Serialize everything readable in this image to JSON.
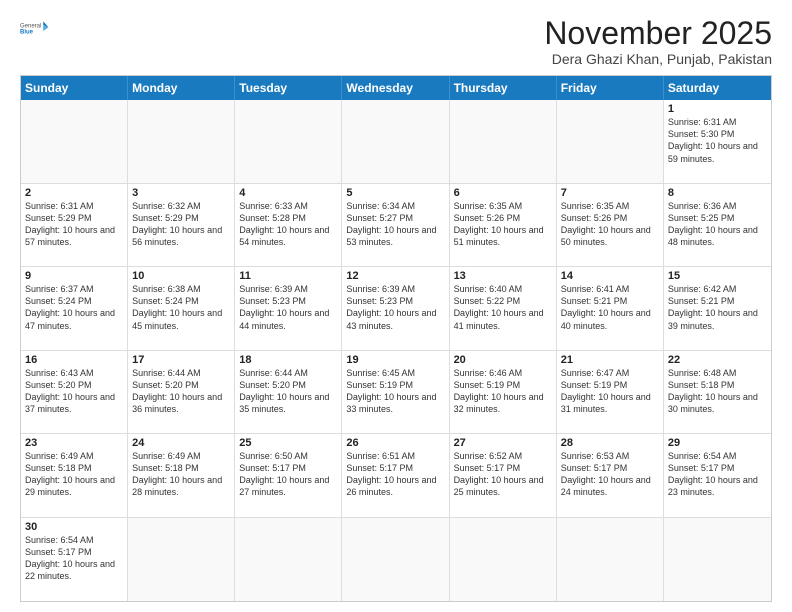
{
  "header": {
    "logo_general": "General",
    "logo_blue": "Blue",
    "month_title": "November 2025",
    "location": "Dera Ghazi Khan, Punjab, Pakistan"
  },
  "days_of_week": [
    "Sunday",
    "Monday",
    "Tuesday",
    "Wednesday",
    "Thursday",
    "Friday",
    "Saturday"
  ],
  "weeks": [
    [
      {
        "day": "",
        "empty": true
      },
      {
        "day": "",
        "empty": true
      },
      {
        "day": "",
        "empty": true
      },
      {
        "day": "",
        "empty": true
      },
      {
        "day": "",
        "empty": true
      },
      {
        "day": "",
        "empty": true
      },
      {
        "day": "1",
        "sunrise": "6:31 AM",
        "sunset": "5:30 PM",
        "daylight": "10 hours and 59 minutes."
      }
    ],
    [
      {
        "day": "2",
        "sunrise": "6:31 AM",
        "sunset": "5:29 PM",
        "daylight": "10 hours and 57 minutes."
      },
      {
        "day": "3",
        "sunrise": "6:32 AM",
        "sunset": "5:29 PM",
        "daylight": "10 hours and 56 minutes."
      },
      {
        "day": "4",
        "sunrise": "6:33 AM",
        "sunset": "5:28 PM",
        "daylight": "10 hours and 54 minutes."
      },
      {
        "day": "5",
        "sunrise": "6:34 AM",
        "sunset": "5:27 PM",
        "daylight": "10 hours and 53 minutes."
      },
      {
        "day": "6",
        "sunrise": "6:35 AM",
        "sunset": "5:26 PM",
        "daylight": "10 hours and 51 minutes."
      },
      {
        "day": "7",
        "sunrise": "6:35 AM",
        "sunset": "5:26 PM",
        "daylight": "10 hours and 50 minutes."
      },
      {
        "day": "8",
        "sunrise": "6:36 AM",
        "sunset": "5:25 PM",
        "daylight": "10 hours and 48 minutes."
      }
    ],
    [
      {
        "day": "9",
        "sunrise": "6:37 AM",
        "sunset": "5:24 PM",
        "daylight": "10 hours and 47 minutes."
      },
      {
        "day": "10",
        "sunrise": "6:38 AM",
        "sunset": "5:24 PM",
        "daylight": "10 hours and 45 minutes."
      },
      {
        "day": "11",
        "sunrise": "6:39 AM",
        "sunset": "5:23 PM",
        "daylight": "10 hours and 44 minutes."
      },
      {
        "day": "12",
        "sunrise": "6:39 AM",
        "sunset": "5:23 PM",
        "daylight": "10 hours and 43 minutes."
      },
      {
        "day": "13",
        "sunrise": "6:40 AM",
        "sunset": "5:22 PM",
        "daylight": "10 hours and 41 minutes."
      },
      {
        "day": "14",
        "sunrise": "6:41 AM",
        "sunset": "5:21 PM",
        "daylight": "10 hours and 40 minutes."
      },
      {
        "day": "15",
        "sunrise": "6:42 AM",
        "sunset": "5:21 PM",
        "daylight": "10 hours and 39 minutes."
      }
    ],
    [
      {
        "day": "16",
        "sunrise": "6:43 AM",
        "sunset": "5:20 PM",
        "daylight": "10 hours and 37 minutes."
      },
      {
        "day": "17",
        "sunrise": "6:44 AM",
        "sunset": "5:20 PM",
        "daylight": "10 hours and 36 minutes."
      },
      {
        "day": "18",
        "sunrise": "6:44 AM",
        "sunset": "5:20 PM",
        "daylight": "10 hours and 35 minutes."
      },
      {
        "day": "19",
        "sunrise": "6:45 AM",
        "sunset": "5:19 PM",
        "daylight": "10 hours and 33 minutes."
      },
      {
        "day": "20",
        "sunrise": "6:46 AM",
        "sunset": "5:19 PM",
        "daylight": "10 hours and 32 minutes."
      },
      {
        "day": "21",
        "sunrise": "6:47 AM",
        "sunset": "5:19 PM",
        "daylight": "10 hours and 31 minutes."
      },
      {
        "day": "22",
        "sunrise": "6:48 AM",
        "sunset": "5:18 PM",
        "daylight": "10 hours and 30 minutes."
      }
    ],
    [
      {
        "day": "23",
        "sunrise": "6:49 AM",
        "sunset": "5:18 PM",
        "daylight": "10 hours and 29 minutes."
      },
      {
        "day": "24",
        "sunrise": "6:49 AM",
        "sunset": "5:18 PM",
        "daylight": "10 hours and 28 minutes."
      },
      {
        "day": "25",
        "sunrise": "6:50 AM",
        "sunset": "5:17 PM",
        "daylight": "10 hours and 27 minutes."
      },
      {
        "day": "26",
        "sunrise": "6:51 AM",
        "sunset": "5:17 PM",
        "daylight": "10 hours and 26 minutes."
      },
      {
        "day": "27",
        "sunrise": "6:52 AM",
        "sunset": "5:17 PM",
        "daylight": "10 hours and 25 minutes."
      },
      {
        "day": "28",
        "sunrise": "6:53 AM",
        "sunset": "5:17 PM",
        "daylight": "10 hours and 24 minutes."
      },
      {
        "day": "29",
        "sunrise": "6:54 AM",
        "sunset": "5:17 PM",
        "daylight": "10 hours and 23 minutes."
      }
    ],
    [
      {
        "day": "30",
        "sunrise": "6:54 AM",
        "sunset": "5:17 PM",
        "daylight": "10 hours and 22 minutes."
      },
      {
        "day": "",
        "empty": true
      },
      {
        "day": "",
        "empty": true
      },
      {
        "day": "",
        "empty": true
      },
      {
        "day": "",
        "empty": true
      },
      {
        "day": "",
        "empty": true
      },
      {
        "day": "",
        "empty": true
      }
    ]
  ],
  "labels": {
    "sunrise_prefix": "Sunrise: ",
    "sunset_prefix": "Sunset: ",
    "daylight_prefix": "Daylight: "
  }
}
